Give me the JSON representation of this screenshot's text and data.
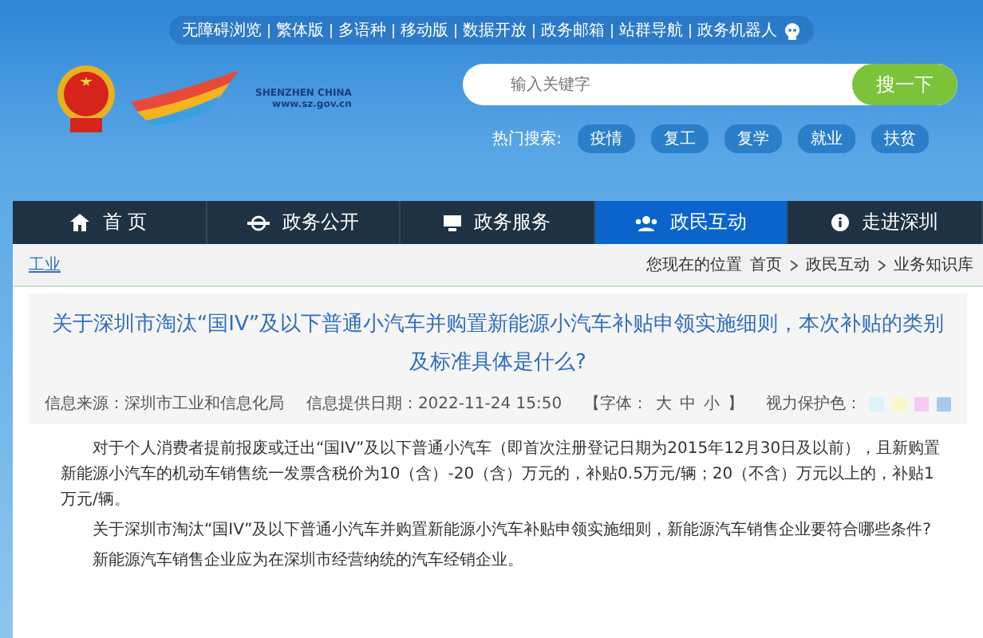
{
  "top_links": [
    "无障碍浏览",
    "繁体版",
    "多语种",
    "移动版",
    "数据开放",
    "政务邮箱",
    "站群导航",
    "政务机器人"
  ],
  "logo": {
    "name": "SHENZHEN CHINA",
    "url": "www.sz.gov.cn"
  },
  "search": {
    "placeholder": "输入关键字",
    "button": "搜一下"
  },
  "hot_search": {
    "label": "热门搜索:",
    "items": [
      "疫情",
      "复工",
      "复学",
      "就业",
      "扶贫"
    ]
  },
  "nav": [
    {
      "label": "首 页",
      "selected": false
    },
    {
      "label": "政务公开",
      "selected": false
    },
    {
      "label": "政务服务",
      "selected": false
    },
    {
      "label": "政民互动",
      "selected": true
    },
    {
      "label": "走进深圳",
      "selected": false
    }
  ],
  "breadcrumb": {
    "section": "工业",
    "label": "您现在的位置",
    "path": [
      "首页",
      "政民互动",
      "业务知识库"
    ]
  },
  "article": {
    "title": "关于深圳市淘汰“国IV”及以下普通小汽车并购置新能源小汽车补贴申领实施细则，本次补贴的类别及标准具体是什么?",
    "source": "信息来源：深圳市工业和信息化局",
    "date": "信息提供日期：2022-11-24 15:50",
    "font_label": "【字体：",
    "font_sizes": [
      "大",
      "中",
      "小"
    ],
    "font_end": "】",
    "eye_label": "视力保护色：",
    "eye_colors": [
      {
        "color": "#d9f4fb"
      },
      {
        "color": "#fbf6c8"
      },
      {
        "color": "#f9c9f2"
      },
      {
        "color": "#a9c9ef"
      }
    ],
    "paragraphs": [
      "对于个人消费者提前报废或迁出“国IV”及以下普通小汽车（即首次注册登记日期为2015年12月30日及以前），且新购置新能源小汽车的机动车销售统一发票含税价为10（含）-20（含）万元的，补贴0.5万元/辆；20（不含）万元以上的，补贴1万元/辆。",
      "关于深圳市淘汰“国IV”及以下普通小汽车并购置新能源小汽车补贴申领实施细则，新能源汽车销售企业要符合哪些条件?",
      "新能源汽车销售企业应为在深圳市经营纳统的汽车经销企业。"
    ]
  }
}
